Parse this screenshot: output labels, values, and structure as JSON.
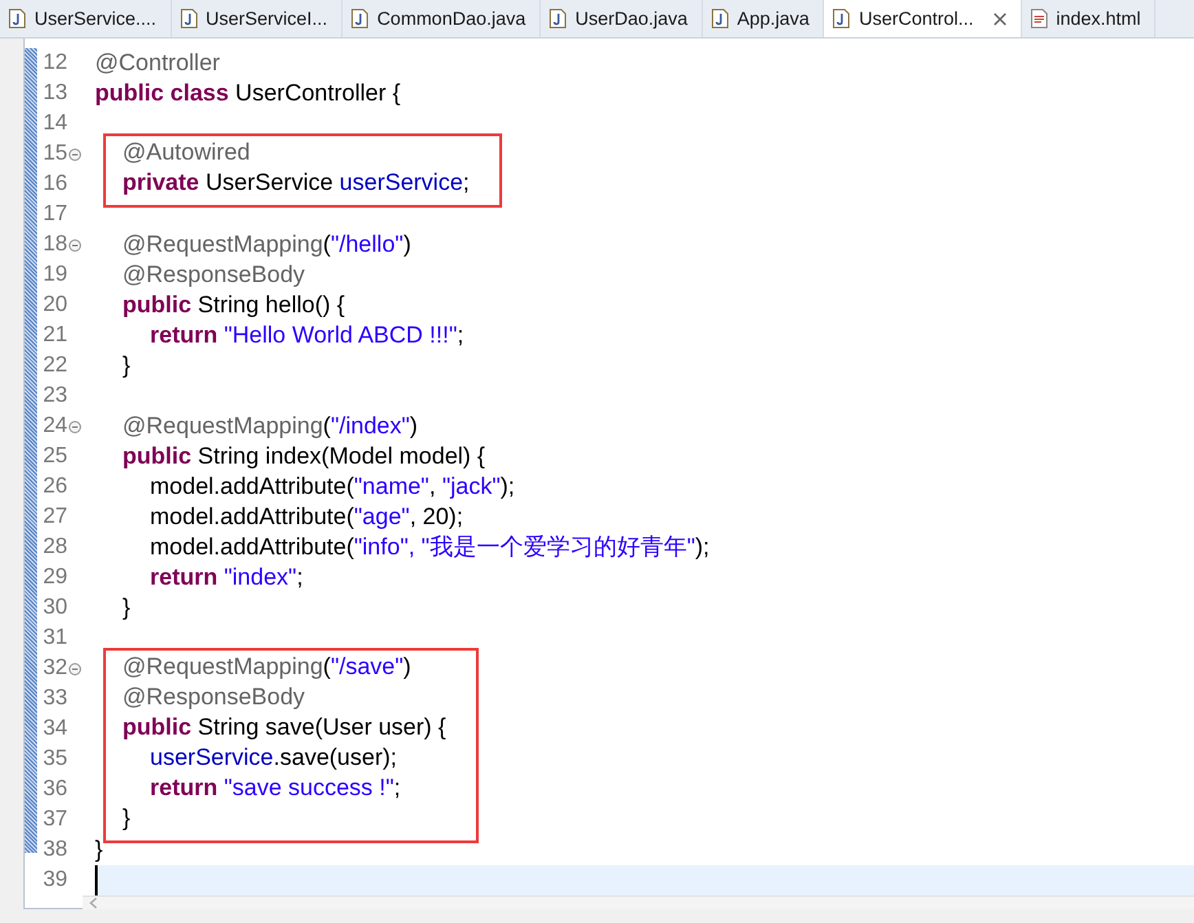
{
  "tabs": [
    {
      "label": "UserService....",
      "kind": "java",
      "selected": false
    },
    {
      "label": "UserServiceI...",
      "kind": "java",
      "selected": false
    },
    {
      "label": "CommonDao.java",
      "kind": "java",
      "selected": false
    },
    {
      "label": "UserDao.java",
      "kind": "java",
      "selected": false
    },
    {
      "label": "App.java",
      "kind": "java",
      "selected": false
    },
    {
      "label": "UserControl...",
      "kind": "java",
      "selected": true
    },
    {
      "label": "index.html",
      "kind": "html",
      "selected": false
    }
  ],
  "editor": {
    "blocks": [
      {
        "boxed": false,
        "lines": [
          {
            "number": "12",
            "kind": "outer",
            "current": false,
            "code": [
              {
                "kind": "annotation",
                "text": "@Controller"
              }
            ]
          },
          {
            "number": "13",
            "kind": "outer",
            "current": false,
            "code": [
              {
                "kind": "keyword",
                "text": "public class"
              },
              {
                "kind": "plain",
                "text": " UserController {"
              }
            ]
          },
          {
            "number": "14",
            "kind": "blank",
            "current": false
          }
        ]
      },
      {
        "boxed": true,
        "lines": [
          {
            "number": "15",
            "kind": "member",
            "current": false,
            "expanded": true,
            "code": [
              {
                "kind": "annotation",
                "text": "@Autowired"
              }
            ]
          },
          {
            "number": "16",
            "kind": "member",
            "current": false,
            "code": [
              {
                "kind": "keyword",
                "text": "private"
              },
              {
                "kind": "plain",
                "text": " UserService "
              },
              {
                "kind": "field",
                "text": "userService"
              },
              {
                "kind": "plain",
                "text": ";"
              }
            ]
          }
        ]
      },
      {
        "boxed": false,
        "lines": [
          {
            "number": "17",
            "kind": "blank",
            "current": false
          },
          {
            "number": "18",
            "kind": "member",
            "current": false,
            "expanded": true,
            "code": [
              {
                "kind": "annotation",
                "text": "@RequestMapping"
              },
              {
                "kind": "plain",
                "text": "("
              },
              {
                "kind": "string",
                "text": "\"/hello\""
              },
              {
                "kind": "plain",
                "text": ")"
              }
            ]
          },
          {
            "number": "19",
            "kind": "member",
            "current": false,
            "code": [
              {
                "kind": "annotation",
                "text": "@ResponseBody"
              }
            ]
          },
          {
            "number": "20",
            "kind": "member",
            "current": false,
            "code": [
              {
                "kind": "keyword",
                "text": "public"
              },
              {
                "kind": "plain",
                "text": " String hello() {"
              }
            ]
          },
          {
            "number": "21",
            "kind": "body",
            "current": false,
            "code": [
              {
                "kind": "keyword",
                "text": "return"
              },
              {
                "kind": "string",
                "text": " \"Hello World ABCD !!!\""
              },
              {
                "kind": "plain",
                "text": ";"
              }
            ]
          },
          {
            "number": "22",
            "kind": "member",
            "current": false,
            "code": [
              {
                "kind": "plain",
                "text": "}"
              }
            ]
          },
          {
            "number": "23",
            "kind": "blank",
            "current": false
          },
          {
            "number": "24",
            "kind": "member",
            "current": false,
            "expanded": true,
            "code": [
              {
                "kind": "annotation",
                "text": "@RequestMapping"
              },
              {
                "kind": "plain",
                "text": "("
              },
              {
                "kind": "string",
                "text": "\"/index\""
              },
              {
                "kind": "plain",
                "text": ")"
              }
            ]
          },
          {
            "number": "25",
            "kind": "member",
            "current": false,
            "code": [
              {
                "kind": "keyword",
                "text": "public"
              },
              {
                "kind": "plain",
                "text": " String index(Model model) {"
              }
            ]
          },
          {
            "number": "26",
            "kind": "body",
            "current": false,
            "code": [
              {
                "kind": "plain",
                "text": "model.addAttribute("
              },
              {
                "kind": "string",
                "text": "\"name\""
              },
              {
                "kind": "plain",
                "text": ", "
              },
              {
                "kind": "string",
                "text": "\"jack\""
              },
              {
                "kind": "plain",
                "text": ");"
              }
            ]
          },
          {
            "number": "27",
            "kind": "body",
            "current": false,
            "code": [
              {
                "kind": "plain",
                "text": "model.addAttribute("
              },
              {
                "kind": "string",
                "text": "\"age\""
              },
              {
                "kind": "plain",
                "text": ", 20);"
              }
            ]
          },
          {
            "number": "28",
            "kind": "body",
            "current": false,
            "code": [
              {
                "kind": "plain",
                "text": "model.addAttribute("
              },
              {
                "kind": "string",
                "text": "\"info\", \"我是一个爱学习的好青年\""
              },
              {
                "kind": "plain",
                "text": ");"
              }
            ]
          },
          {
            "number": "29",
            "kind": "body",
            "current": false,
            "code": [
              {
                "kind": "keyword",
                "text": "return"
              },
              {
                "kind": "string",
                "text": " \"index\""
              },
              {
                "kind": "plain",
                "text": ";"
              }
            ]
          },
          {
            "number": "30",
            "kind": "member",
            "current": false,
            "code": [
              {
                "kind": "plain",
                "text": "}"
              }
            ]
          },
          {
            "number": "31",
            "kind": "blank",
            "current": false
          }
        ]
      },
      {
        "boxed": true,
        "lines": [
          {
            "number": "32",
            "kind": "member",
            "current": false,
            "expanded": true,
            "code": [
              {
                "kind": "annotation",
                "text": "@RequestMapping"
              },
              {
                "kind": "plain",
                "text": "("
              },
              {
                "kind": "string",
                "text": "\"/save\""
              },
              {
                "kind": "plain",
                "text": ")"
              }
            ]
          },
          {
            "number": "33",
            "kind": "member",
            "current": false,
            "code": [
              {
                "kind": "annotation",
                "text": "@ResponseBody"
              }
            ]
          },
          {
            "number": "34",
            "kind": "member",
            "current": false,
            "code": [
              {
                "kind": "keyword",
                "text": "public"
              },
              {
                "kind": "plain",
                "text": " String save(User user) {"
              }
            ]
          },
          {
            "number": "35",
            "kind": "body",
            "current": false,
            "code": [
              {
                "kind": "field",
                "text": "userService"
              },
              {
                "kind": "plain",
                "text": ".save(user);"
              }
            ]
          },
          {
            "number": "36",
            "kind": "body",
            "current": false,
            "code": [
              {
                "kind": "keyword",
                "text": "return"
              },
              {
                "kind": "string",
                "text": " \"save success !\""
              },
              {
                "kind": "plain",
                "text": ";"
              }
            ]
          },
          {
            "number": "37",
            "kind": "member",
            "current": false,
            "code": [
              {
                "kind": "plain",
                "text": "}"
              }
            ]
          }
        ]
      },
      {
        "boxed": false,
        "lines": [
          {
            "number": "38",
            "kind": "outer",
            "current": false,
            "code": [
              {
                "kind": "plain",
                "text": "}"
              }
            ]
          },
          {
            "number": "39",
            "kind": "blank",
            "current": true
          }
        ]
      }
    ]
  }
}
